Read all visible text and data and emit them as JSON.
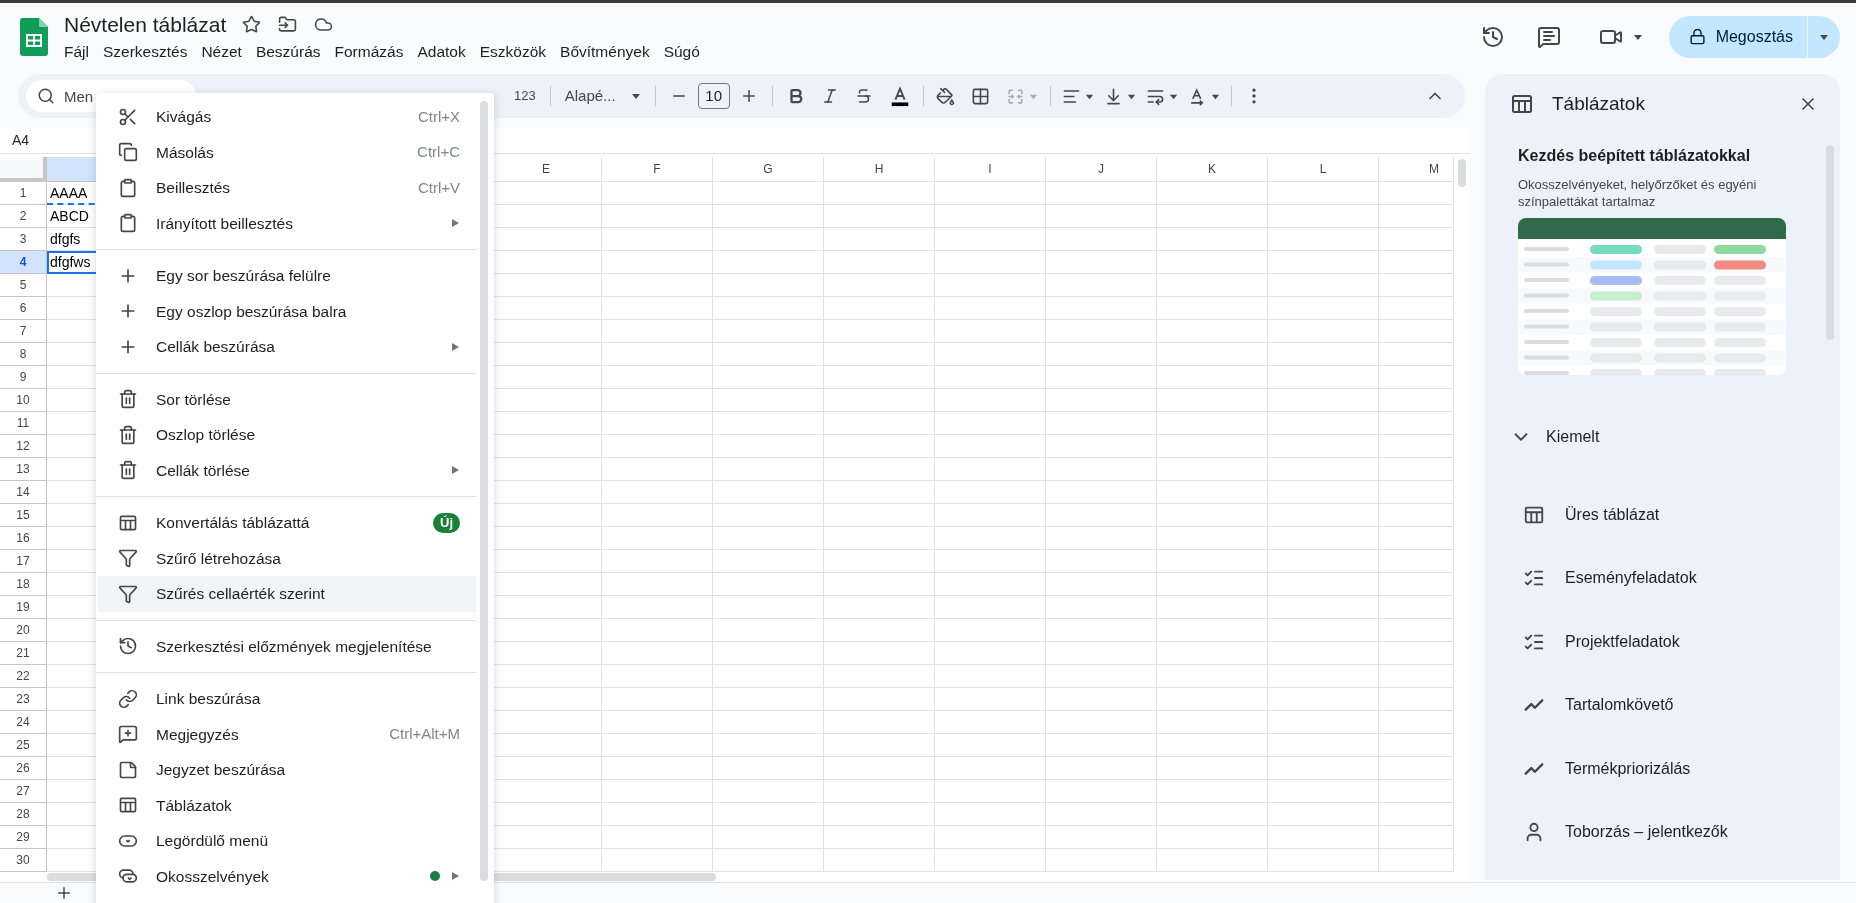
{
  "app": {
    "title": "Névtelen táblázat",
    "menus": [
      "Fájl",
      "Szerkesztés",
      "Nézet",
      "Beszúrás",
      "Formázás",
      "Adatok",
      "Eszközök",
      "Bővítmények",
      "Súgó"
    ],
    "share_button": "Megosztás"
  },
  "toolbar": {
    "search_placeholder": "Men",
    "number_format": "123",
    "font": "Alapé...",
    "font_size": "10",
    "merge_disabled": true
  },
  "name_box": "A4",
  "grid": {
    "columns": [
      "E",
      "F",
      "G",
      "H",
      "I",
      "J",
      "K",
      "L",
      "M"
    ],
    "rows": [
      {
        "number": "1",
        "value": "AAAA",
        "copied": true,
        "selected": false
      },
      {
        "number": "2",
        "value": "ABCD",
        "copied": false,
        "selected": false
      },
      {
        "number": "3",
        "value": "dfgfs",
        "copied": false,
        "selected": false
      },
      {
        "number": "4",
        "value": "dfgfws",
        "copied": false,
        "selected": true
      },
      {
        "number": "5",
        "copied": false,
        "selected": false
      },
      {
        "number": "6",
        "copied": false,
        "selected": false
      },
      {
        "number": "7",
        "copied": false,
        "selected": false
      },
      {
        "number": "8",
        "copied": false,
        "selected": false
      },
      {
        "number": "9",
        "copied": false,
        "selected": false
      },
      {
        "number": "10",
        "copied": false,
        "selected": false
      },
      {
        "number": "11",
        "copied": false,
        "selected": false
      },
      {
        "number": "12",
        "copied": false,
        "selected": false
      },
      {
        "number": "13",
        "copied": false,
        "selected": false
      },
      {
        "number": "14",
        "copied": false,
        "selected": false
      },
      {
        "number": "15",
        "copied": false,
        "selected": false
      },
      {
        "number": "16",
        "copied": false,
        "selected": false
      },
      {
        "number": "17",
        "copied": false,
        "selected": false
      },
      {
        "number": "18",
        "copied": false,
        "selected": false
      },
      {
        "number": "19",
        "copied": false,
        "selected": false
      },
      {
        "number": "20",
        "copied": false,
        "selected": false
      },
      {
        "number": "21",
        "copied": false,
        "selected": false
      },
      {
        "number": "22",
        "copied": false,
        "selected": false
      },
      {
        "number": "23",
        "copied": false,
        "selected": false
      },
      {
        "number": "24",
        "copied": false,
        "selected": false
      },
      {
        "number": "25",
        "copied": false,
        "selected": false
      },
      {
        "number": "26",
        "copied": false,
        "selected": false
      },
      {
        "number": "27",
        "copied": false,
        "selected": false
      },
      {
        "number": "28",
        "copied": false,
        "selected": false
      },
      {
        "number": "29",
        "copied": false,
        "selected": false
      },
      {
        "number": "30",
        "copied": false,
        "selected": false
      }
    ]
  },
  "context_menu": {
    "sections": [
      {
        "items": [
          {
            "label": "Kivágás",
            "shortcut": "Ctrl+X",
            "submenu": false,
            "highlighted": false,
            "dot": false
          },
          {
            "label": "Másolás",
            "shortcut": "Ctrl+C",
            "submenu": false,
            "highlighted": false,
            "dot": false
          },
          {
            "label": "Beillesztés",
            "shortcut": "Ctrl+V",
            "submenu": false,
            "highlighted": false,
            "dot": false
          },
          {
            "label": "Irányított beillesztés",
            "submenu": true,
            "highlighted": false,
            "dot": false
          }
        ]
      },
      {
        "items": [
          {
            "label": "Egy sor beszúrása felülre",
            "submenu": false,
            "highlighted": false,
            "dot": false
          },
          {
            "label": "Egy oszlop beszúrása balra",
            "submenu": false,
            "highlighted": false,
            "dot": false
          },
          {
            "label": "Cellák beszúrása",
            "submenu": true,
            "highlighted": false,
            "dot": false
          }
        ]
      },
      {
        "items": [
          {
            "label": "Sor törlése",
            "submenu": false,
            "highlighted": false,
            "dot": false
          },
          {
            "label": "Oszlop törlése",
            "submenu": false,
            "highlighted": false,
            "dot": false
          },
          {
            "label": "Cellák törlése",
            "submenu": true,
            "highlighted": false,
            "dot": false
          }
        ]
      },
      {
        "items": [
          {
            "label": "Konvertálás táblázattá",
            "badge": "Új",
            "submenu": false,
            "highlighted": false,
            "dot": false
          },
          {
            "label": "Szűrő létrehozása",
            "submenu": false,
            "highlighted": false,
            "dot": false
          },
          {
            "label": "Szűrés cellaérték szerint",
            "submenu": false,
            "highlighted": true,
            "dot": false
          }
        ]
      },
      {
        "items": [
          {
            "label": "Szerkesztési előzmények megjelenítése",
            "submenu": false,
            "highlighted": false,
            "dot": false
          }
        ]
      },
      {
        "items": [
          {
            "label": "Link beszúrása",
            "submenu": false,
            "highlighted": false,
            "dot": false
          },
          {
            "label": "Megjegyzés",
            "shortcut": "Ctrl+Alt+M",
            "submenu": false,
            "highlighted": false,
            "dot": false
          },
          {
            "label": "Jegyzet beszúrása",
            "submenu": false,
            "highlighted": false,
            "dot": false
          },
          {
            "label": "Táblázatok",
            "submenu": false,
            "highlighted": false,
            "dot": false
          },
          {
            "label": "Legördülő menü",
            "submenu": false,
            "highlighted": false,
            "dot": false
          },
          {
            "label": "Okosszelvények",
            "submenu": true,
            "highlighted": false,
            "dot": true
          }
        ]
      }
    ]
  },
  "panel": {
    "title": "Táblázatok",
    "intro_title": "Kezdés beépített táblázatokkal",
    "intro_text": "Okosszelvényeket, helyőrzőket és egyéni színpalettákat tartalmaz",
    "section": {
      "label": "Kiemelt",
      "expanded": true,
      "items": [
        "Üres táblázat",
        "Eseményfeladatok",
        "Projektfeladatok",
        "Tartalomkövető",
        "Termékpriorizálás",
        "Toborzás – jelentkezők"
      ]
    }
  }
}
